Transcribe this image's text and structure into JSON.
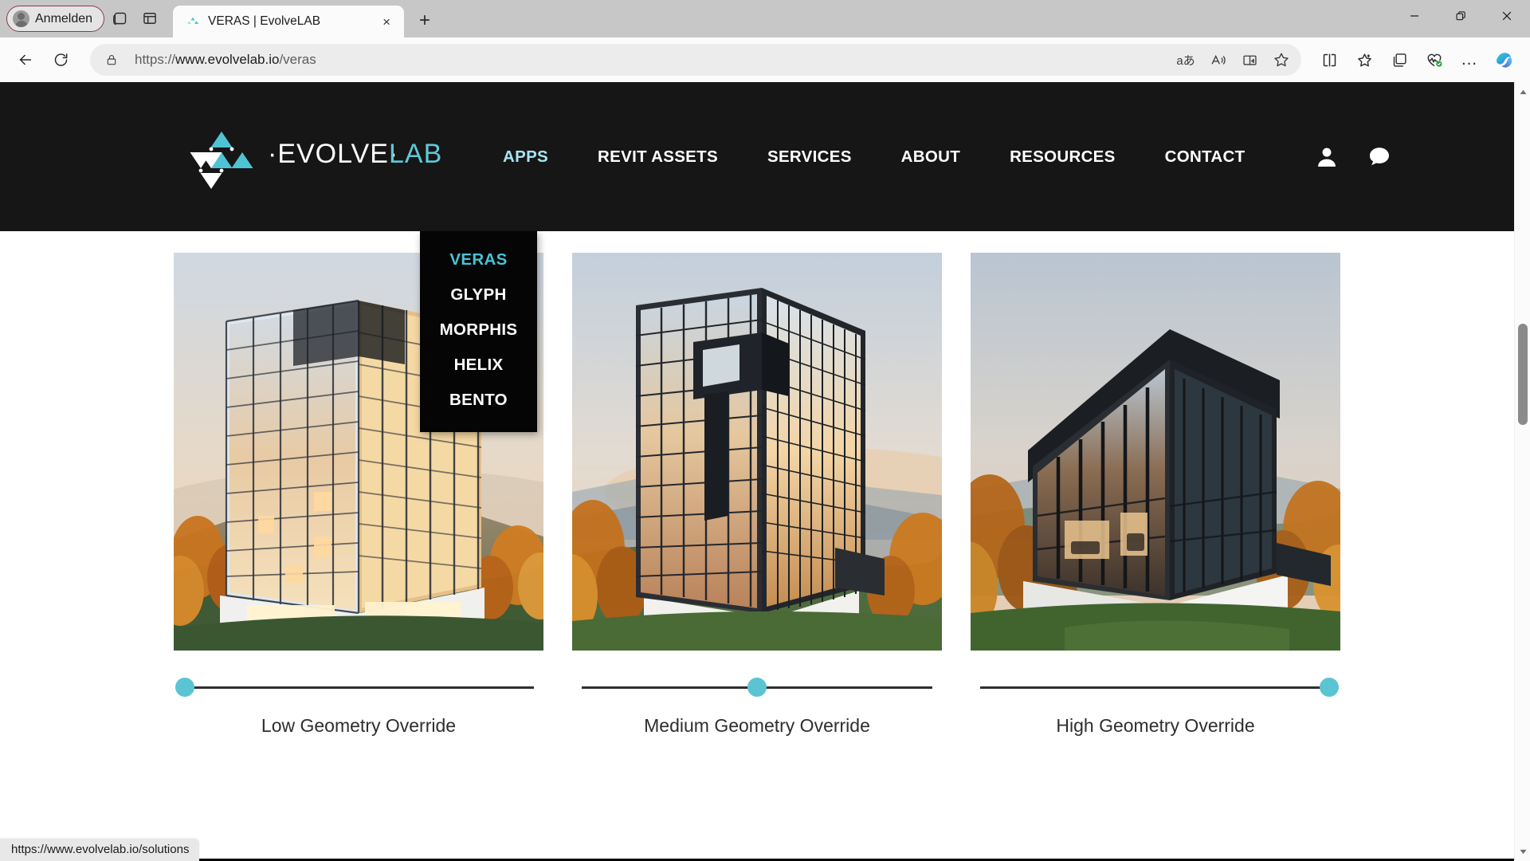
{
  "browser": {
    "profile": {
      "label": "Anmelden",
      "icon": "account-avatar-icon"
    },
    "toolbar_left_icons": [
      {
        "name": "workspaces-icon",
        "title": "Arbeitsbereiche"
      },
      {
        "name": "split-pane-icon",
        "title": "Browser-Grundfunktionen"
      }
    ],
    "tab": {
      "title": "VERAS | EvolveLAB",
      "favicon": "evolvelab-favicon",
      "close_label": "×"
    },
    "new_tab_label": "+",
    "window_controls": {
      "minimize": "—",
      "restore": "❐",
      "close": "✕"
    },
    "back_label": "←",
    "refresh_label": "↻",
    "address": {
      "scheme": "https://",
      "host": "www.evolvelab.io",
      "path": "/veras",
      "full": "https://www.evolvelab.io/veras",
      "lock_icon": "lock-icon"
    },
    "omnibox_icons": [
      {
        "name": "translate-icon",
        "glyph": "aあ"
      },
      {
        "name": "read-aloud-icon",
        "glyph": "A"
      },
      {
        "name": "immersive-reader-icon",
        "glyph": "book"
      },
      {
        "name": "favorite-star-icon",
        "glyph": "☆"
      }
    ],
    "toolbar_icons": [
      {
        "name": "split-screen-icon"
      },
      {
        "name": "favorites-icon"
      },
      {
        "name": "collections-icon"
      },
      {
        "name": "browser-essentials-icon"
      },
      {
        "name": "settings-more-icon",
        "glyph": "…"
      },
      {
        "name": "copilot-icon"
      }
    ],
    "status_bubble": "https://www.evolvelab.io/solutions",
    "scrollbar": {
      "up_arrow": "▲",
      "down_arrow": "▼",
      "thumb_top_pct": 31,
      "thumb_height_pct": 13
    }
  },
  "site": {
    "logo": {
      "text_evolve": "·EVOLVE·",
      "text_lab": "LAB",
      "mark": "evolvelab-triangles-logo"
    },
    "nav": [
      {
        "label": "APPS",
        "active": true
      },
      {
        "label": "REVIT ASSETS",
        "active": false
      },
      {
        "label": "SERVICES",
        "active": false
      },
      {
        "label": "ABOUT",
        "active": false
      },
      {
        "label": "RESOURCES",
        "active": false
      },
      {
        "label": "CONTACT",
        "active": false
      }
    ],
    "header_icons": [
      {
        "name": "user-account-icon"
      },
      {
        "name": "chat-bubble-icon"
      }
    ],
    "dropdown": {
      "open_for": "APPS",
      "items": [
        {
          "label": "VERAS",
          "active": true
        },
        {
          "label": "GLYPH",
          "active": false
        },
        {
          "label": "MORPHIS",
          "active": false
        },
        {
          "label": "HELIX",
          "active": false
        },
        {
          "label": "BENTO",
          "active": false
        }
      ]
    },
    "gallery": [
      {
        "caption": "Low Geometry Override",
        "slider_value": 0,
        "image_alt": "Rendered high-rise residential tower at sunset with autumn hillside"
      },
      {
        "caption": "Medium Geometry Override",
        "slider_value": 50,
        "image_alt": "Rendered glass-and-steel gridded tower overlooking misty valley"
      },
      {
        "caption": "High Geometry Override",
        "slider_value": 100,
        "image_alt": "Rendered angular glass pavilion on white plinth with autumn trees"
      }
    ]
  },
  "colors": {
    "header_bg": "#161616",
    "dropdown_bg": "#050505",
    "accent_teal": "#46c3d6",
    "nav_active": "#a9e4f2",
    "slider_thumb": "#5bc4d2",
    "caption_text": "#2e2e2e",
    "logo_lab": "#5ec9da"
  }
}
